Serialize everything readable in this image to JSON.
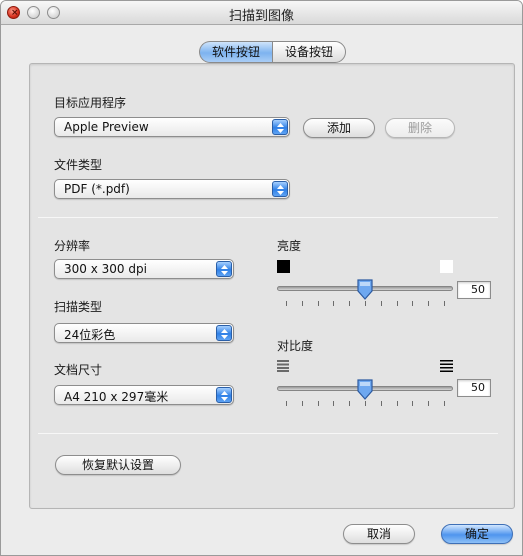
{
  "window": {
    "title": "扫描到图像"
  },
  "tabs": [
    "软件按钮",
    "设备按钮"
  ],
  "target_app": {
    "label": "目标应用程序",
    "value": "Apple Preview",
    "add_label": "添加",
    "delete_label": "删除"
  },
  "file_type": {
    "label": "文件类型",
    "value": "PDF (*.pdf)"
  },
  "resolution": {
    "label": "分辨率",
    "value": "300 x 300 dpi"
  },
  "scan_type": {
    "label": "扫描类型",
    "value": "24位彩色"
  },
  "doc_size": {
    "label": "文档尺寸",
    "value": "A4 210 x 297毫米"
  },
  "brightness": {
    "label": "亮度",
    "value": "50",
    "level": 0.5
  },
  "contrast": {
    "label": "对比度",
    "value": "50",
    "level": 0.5
  },
  "restore_label": "恢复默认设置",
  "cancel_label": "取消",
  "ok_label": "确定",
  "icons": {
    "brightness_low": "black-square-icon",
    "brightness_high": "white-square-icon",
    "contrast_low": "low-contrast-lines-icon",
    "contrast_high": "high-contrast-lines-icon"
  }
}
